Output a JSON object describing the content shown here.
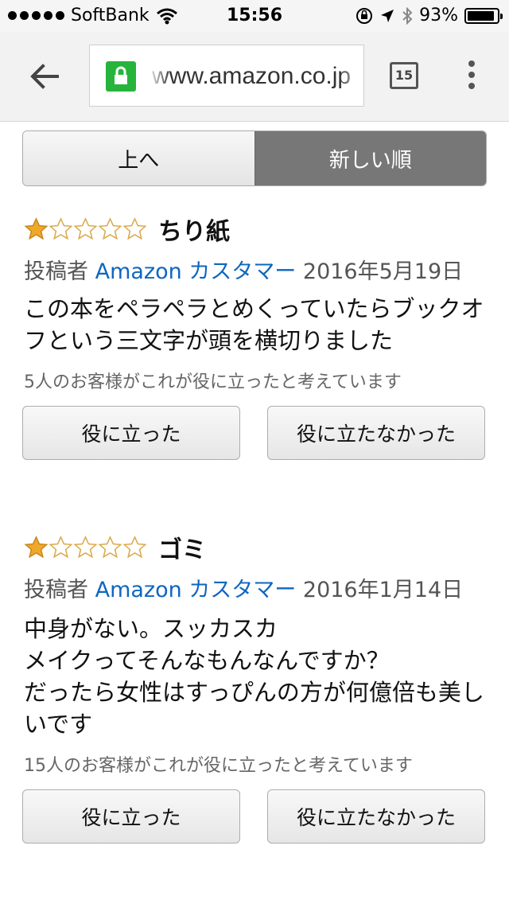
{
  "status_bar": {
    "carrier": "SoftBank",
    "time": "15:56",
    "battery": "93%",
    "battery_level": 0.93
  },
  "browser": {
    "url": "www.amazon.co.jp",
    "tab_count": "15",
    "secure_color": "#27b43c"
  },
  "sort": {
    "up_label": "上へ",
    "newest_label": "新しい順"
  },
  "reviews": [
    {
      "rating": 1,
      "title": "ちり紙",
      "posted_by_label": "投稿者",
      "author": "Amazon カスタマー",
      "date": "2016年5月19日",
      "body": "この本をペラペラとめくっていたらブックオフという三文字が頭を横切りました",
      "helpful_text": "5人のお客様がこれが役に立ったと考えています",
      "helpful_button": "役に立った",
      "not_helpful_button": "役に立たなかった"
    },
    {
      "rating": 1,
      "title": "ゴミ",
      "posted_by_label": "投稿者",
      "author": "Amazon カスタマー",
      "date": "2016年1月14日",
      "body_lines": [
        "中身がない。スッカスカ",
        "メイクってそんなもんなんですか？",
        "だったら女性はすっぴんの方が何億倍も美しいです"
      ],
      "helpful_text": "15人のお客様がこれが役に立ったと考えています",
      "helpful_button": "役に立った",
      "not_helpful_button": "役に立たなかった"
    }
  ],
  "colors": {
    "star_filled": "#f0a82a",
    "star_empty_stroke": "#d9a84a",
    "author_link": "#0f66c0"
  }
}
